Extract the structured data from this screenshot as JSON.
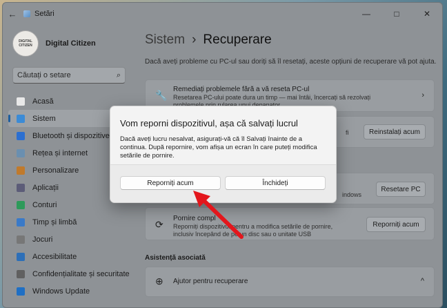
{
  "window": {
    "title": "Setări",
    "back_icon": "←",
    "controls": [
      "—",
      "□",
      "✕"
    ]
  },
  "profile": {
    "name": "Digital Citizen",
    "avatar_text": "DIGITAL CITIZEN"
  },
  "search": {
    "placeholder": "Căutați o setare",
    "icon": "⌕"
  },
  "nav": [
    {
      "label": "Acasă",
      "color": "#e8e8e8",
      "active": false
    },
    {
      "label": "Sistem",
      "color": "#3b8bd6",
      "active": true
    },
    {
      "label": "Bluetooth și dispozitive",
      "color": "#2b6fd1",
      "active": false
    },
    {
      "label": "Rețea și internet",
      "color": "#6a8fb0",
      "active": false
    },
    {
      "label": "Personalizare",
      "color": "#c07a2c",
      "active": false
    },
    {
      "label": "Aplicații",
      "color": "#5c5c78",
      "active": false
    },
    {
      "label": "Conturi",
      "color": "#2e9a5a",
      "active": false
    },
    {
      "label": "Timp și limbă",
      "color": "#3a7ac8",
      "active": false
    },
    {
      "label": "Jocuri",
      "color": "#777777",
      "active": false
    },
    {
      "label": "Accesibilitate",
      "color": "#2d6fb8",
      "active": false
    },
    {
      "label": "Confidențialitate și securitate",
      "color": "#606060",
      "active": false
    },
    {
      "label": "Windows Update",
      "color": "#1f6fc4",
      "active": false
    }
  ],
  "breadcrumb": {
    "parent": "Sistem",
    "separator": "›",
    "current": "Recuperare"
  },
  "subtitle": "Dacă aveți probleme cu PC-ul sau doriți să îl resetați, aceste opțiuni de recuperare vă pot ajuta.",
  "cards": {
    "fix": {
      "title": "Remediați problemele fără a vă reseta PC-ul",
      "desc": "Resetarea PC-ului poate dura un timp — mai întâi, încercați să rezolvați problemele prin rularea unui depanator",
      "chevron": "›"
    },
    "reinstall": {
      "partial": "fi",
      "button": "Reinstalați acum"
    },
    "reset": {
      "partial": "indows",
      "button": "Resetare PC"
    },
    "advanced": {
      "title": "Pornire compl",
      "desc": "Reporniți dispozitivul pentru a modifica setările de pornire, inclusiv începând de pe un disc sau o unitate USB",
      "button": "Reporniți acum"
    },
    "help": {
      "title": "Ajutor pentru recuperare",
      "chevron": "^"
    }
  },
  "section_title": "Asistență asociată",
  "dialog": {
    "title": "Vom reporni dispozitivul, așa că salvați lucrul",
    "text": "Dacă aveți lucru nesalvat, asigurați-vă că îl Salvați înainte de a continua. După repornire, vom afișa un ecran în care puteți modifica setările de pornire.",
    "primary_button": "Reporniți acum",
    "secondary_button": "Închideți"
  },
  "annotation_color": "#e3161c"
}
